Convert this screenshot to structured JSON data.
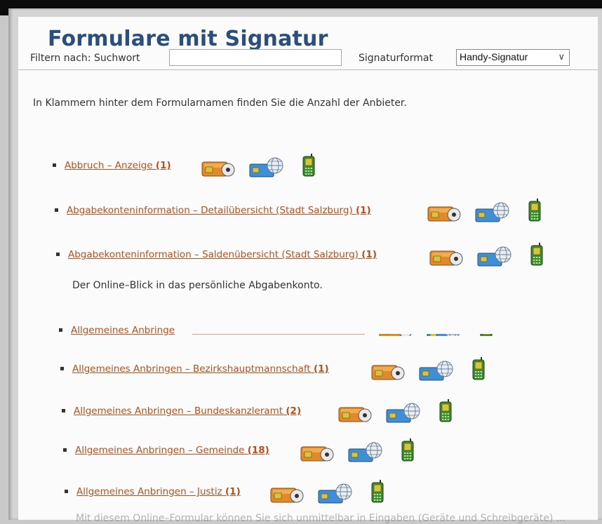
{
  "page": {
    "title": "Formulare mit Signatur"
  },
  "filter": {
    "label": "Filtern nach: Suchwort",
    "search_value": "",
    "format_label": "Signaturformat",
    "format_selected": "Handy-Signatur"
  },
  "intro": "In Klammern hinter dem Formularnamen finden Sie die Anzahl der Anbieter.",
  "forms": [
    {
      "name": "Abbruch – Anzeige",
      "count": "(1)"
    },
    {
      "name": "Abgabekonteninformation – Detailübersicht (Stadt Salzburg)",
      "count": "(1)"
    },
    {
      "name": "Abgabekonteninformation – Saldenübersicht (Stadt Salzburg)",
      "count": "(1)",
      "description": "Der Online–Blick in das persönliche Abgabenkonto."
    },
    {
      "name": "Allgemeines Anbringe",
      "count": ""
    },
    {
      "name": "Allgemeines Anbringen – Bezirkshauptmannschaft",
      "count": "(1)"
    },
    {
      "name": "Allgemeines Anbringen – Bundeskanzleramt",
      "count": "(2)"
    },
    {
      "name": "Allgemeines Anbringen – Gemeinde",
      "count": "(18)"
    },
    {
      "name": "Allgemeines Anbringen – Justiz",
      "count": "(1)",
      "description": "Mit diesem Online–Formular können Sie sich unmittelbar in Eingaben (Geräte und Schreibgeräte) ..."
    }
  ],
  "icons": [
    "card-reader-icon",
    "globe-card-icon",
    "mobile-phone-icon"
  ],
  "colors": {
    "title": "#2b4f7d",
    "link": "#b8501c",
    "text": "#333333"
  }
}
